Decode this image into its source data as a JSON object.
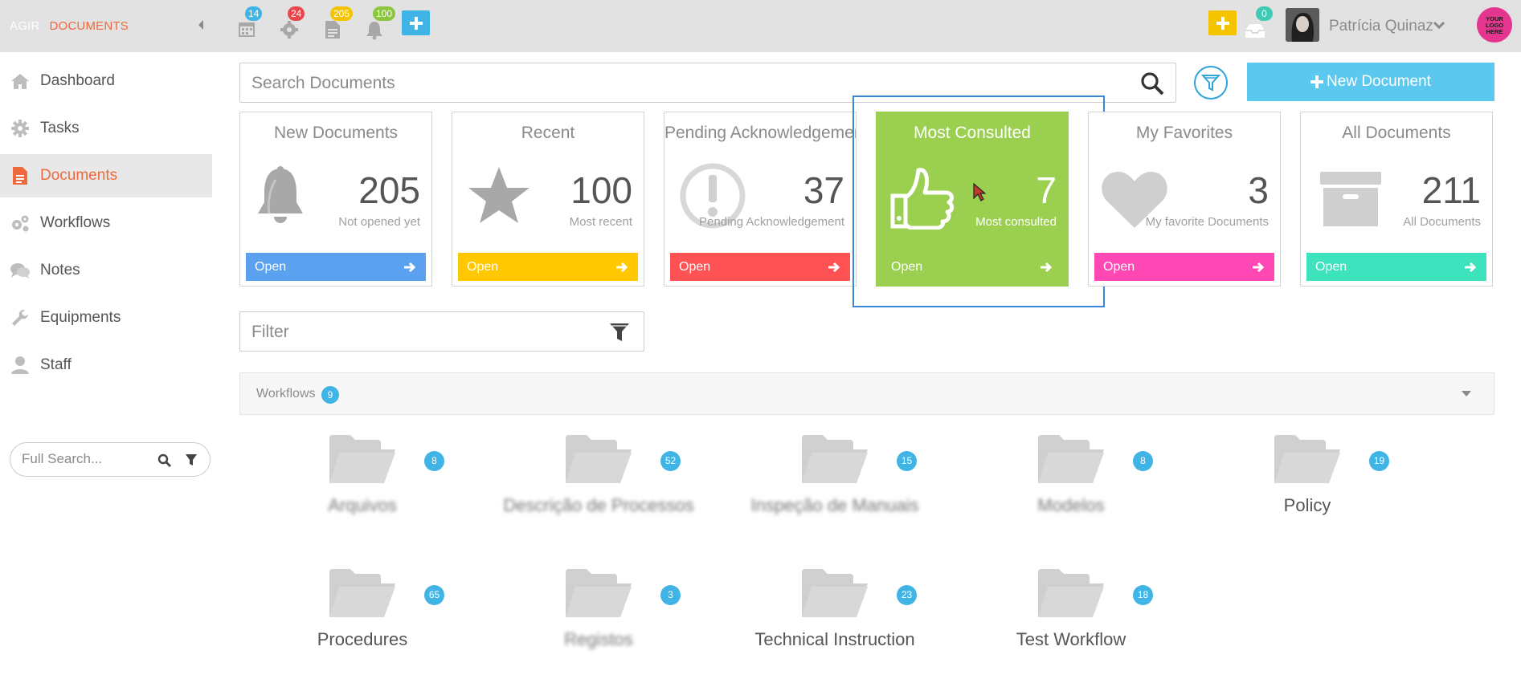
{
  "header": {
    "app_name": "AGIR",
    "module_name": "DOCUMENTS",
    "notifications": [
      {
        "icon": "calendar-icon",
        "count": "14",
        "color": "#40b4e5"
      },
      {
        "icon": "gear-icon",
        "count": "24",
        "color": "#e8474c"
      },
      {
        "icon": "document-icon",
        "count": "205",
        "color": "#f5c400"
      },
      {
        "icon": "bell-icon",
        "count": "100",
        "color": "#8cc63f"
      }
    ],
    "inbox_count": "0",
    "user_name": "Patrícia Quinaz",
    "logo_text": [
      "YOUR",
      "LOGO",
      "HERE"
    ]
  },
  "sidebar": {
    "items": [
      {
        "label": "Dashboard",
        "icon": "home-icon",
        "active": false
      },
      {
        "label": "Tasks",
        "icon": "gear-icon",
        "active": false
      },
      {
        "label": "Documents",
        "icon": "document-icon",
        "active": true
      },
      {
        "label": "Workflows",
        "icon": "gears-icon",
        "active": false
      },
      {
        "label": "Notes",
        "icon": "comments-icon",
        "active": false
      },
      {
        "label": "Equipments",
        "icon": "wrench-icon",
        "active": false
      },
      {
        "label": "Staff",
        "icon": "user-icon",
        "active": false
      }
    ],
    "search_placeholder": "Full Search..."
  },
  "main": {
    "search_placeholder": "Search Documents",
    "new_document_label": "New Document",
    "filter_placeholder": "Filter",
    "cards": [
      {
        "title": "New Documents",
        "count": "205",
        "subtitle": "Not opened yet",
        "open_label": "Open",
        "color": "#5aa1f0",
        "icon": "bell-icon"
      },
      {
        "title": "Recent",
        "count": "100",
        "subtitle": "Most recent",
        "open_label": "Open",
        "color": "#ffc800",
        "icon": "star-icon"
      },
      {
        "title": "Pending Acknowledgement",
        "count": "37",
        "subtitle": "Pending Acknowledgement",
        "open_label": "Open",
        "color": "#ff5254",
        "icon": "exclamation-icon"
      },
      {
        "title": "Most Consulted",
        "count": "7",
        "subtitle": "Most consulted",
        "open_label": "Open",
        "color": "#9acf50",
        "icon": "thumbs-up-icon"
      },
      {
        "title": "My Favorites",
        "count": "3",
        "subtitle": "My favorite Documents",
        "open_label": "Open",
        "color": "#ff48b4",
        "icon": "heart-icon"
      },
      {
        "title": "All Documents",
        "count": "211",
        "subtitle": "All Documents",
        "open_label": "Open",
        "color": "#3ee2bc",
        "icon": "archive-icon"
      }
    ],
    "workflows": {
      "label": "Workflows",
      "count": "9",
      "folders": [
        {
          "name": "Arquivos",
          "count": "8",
          "blurred": true
        },
        {
          "name": "Descrição de Processos",
          "count": "52",
          "blurred": true
        },
        {
          "name": "Inspeção de Manuais",
          "count": "15",
          "blurred": true
        },
        {
          "name": "Modelos",
          "count": "8",
          "blurred": true
        },
        {
          "name": "Policy",
          "count": "19",
          "blurred": false
        },
        {
          "name": "Procedures",
          "count": "65",
          "blurred": false
        },
        {
          "name": "Registos",
          "count": "3",
          "blurred": true
        },
        {
          "name": "Technical Instruction",
          "count": "23",
          "blurred": false
        },
        {
          "name": "Test Workflow",
          "count": "18",
          "blurred": false
        }
      ]
    }
  }
}
